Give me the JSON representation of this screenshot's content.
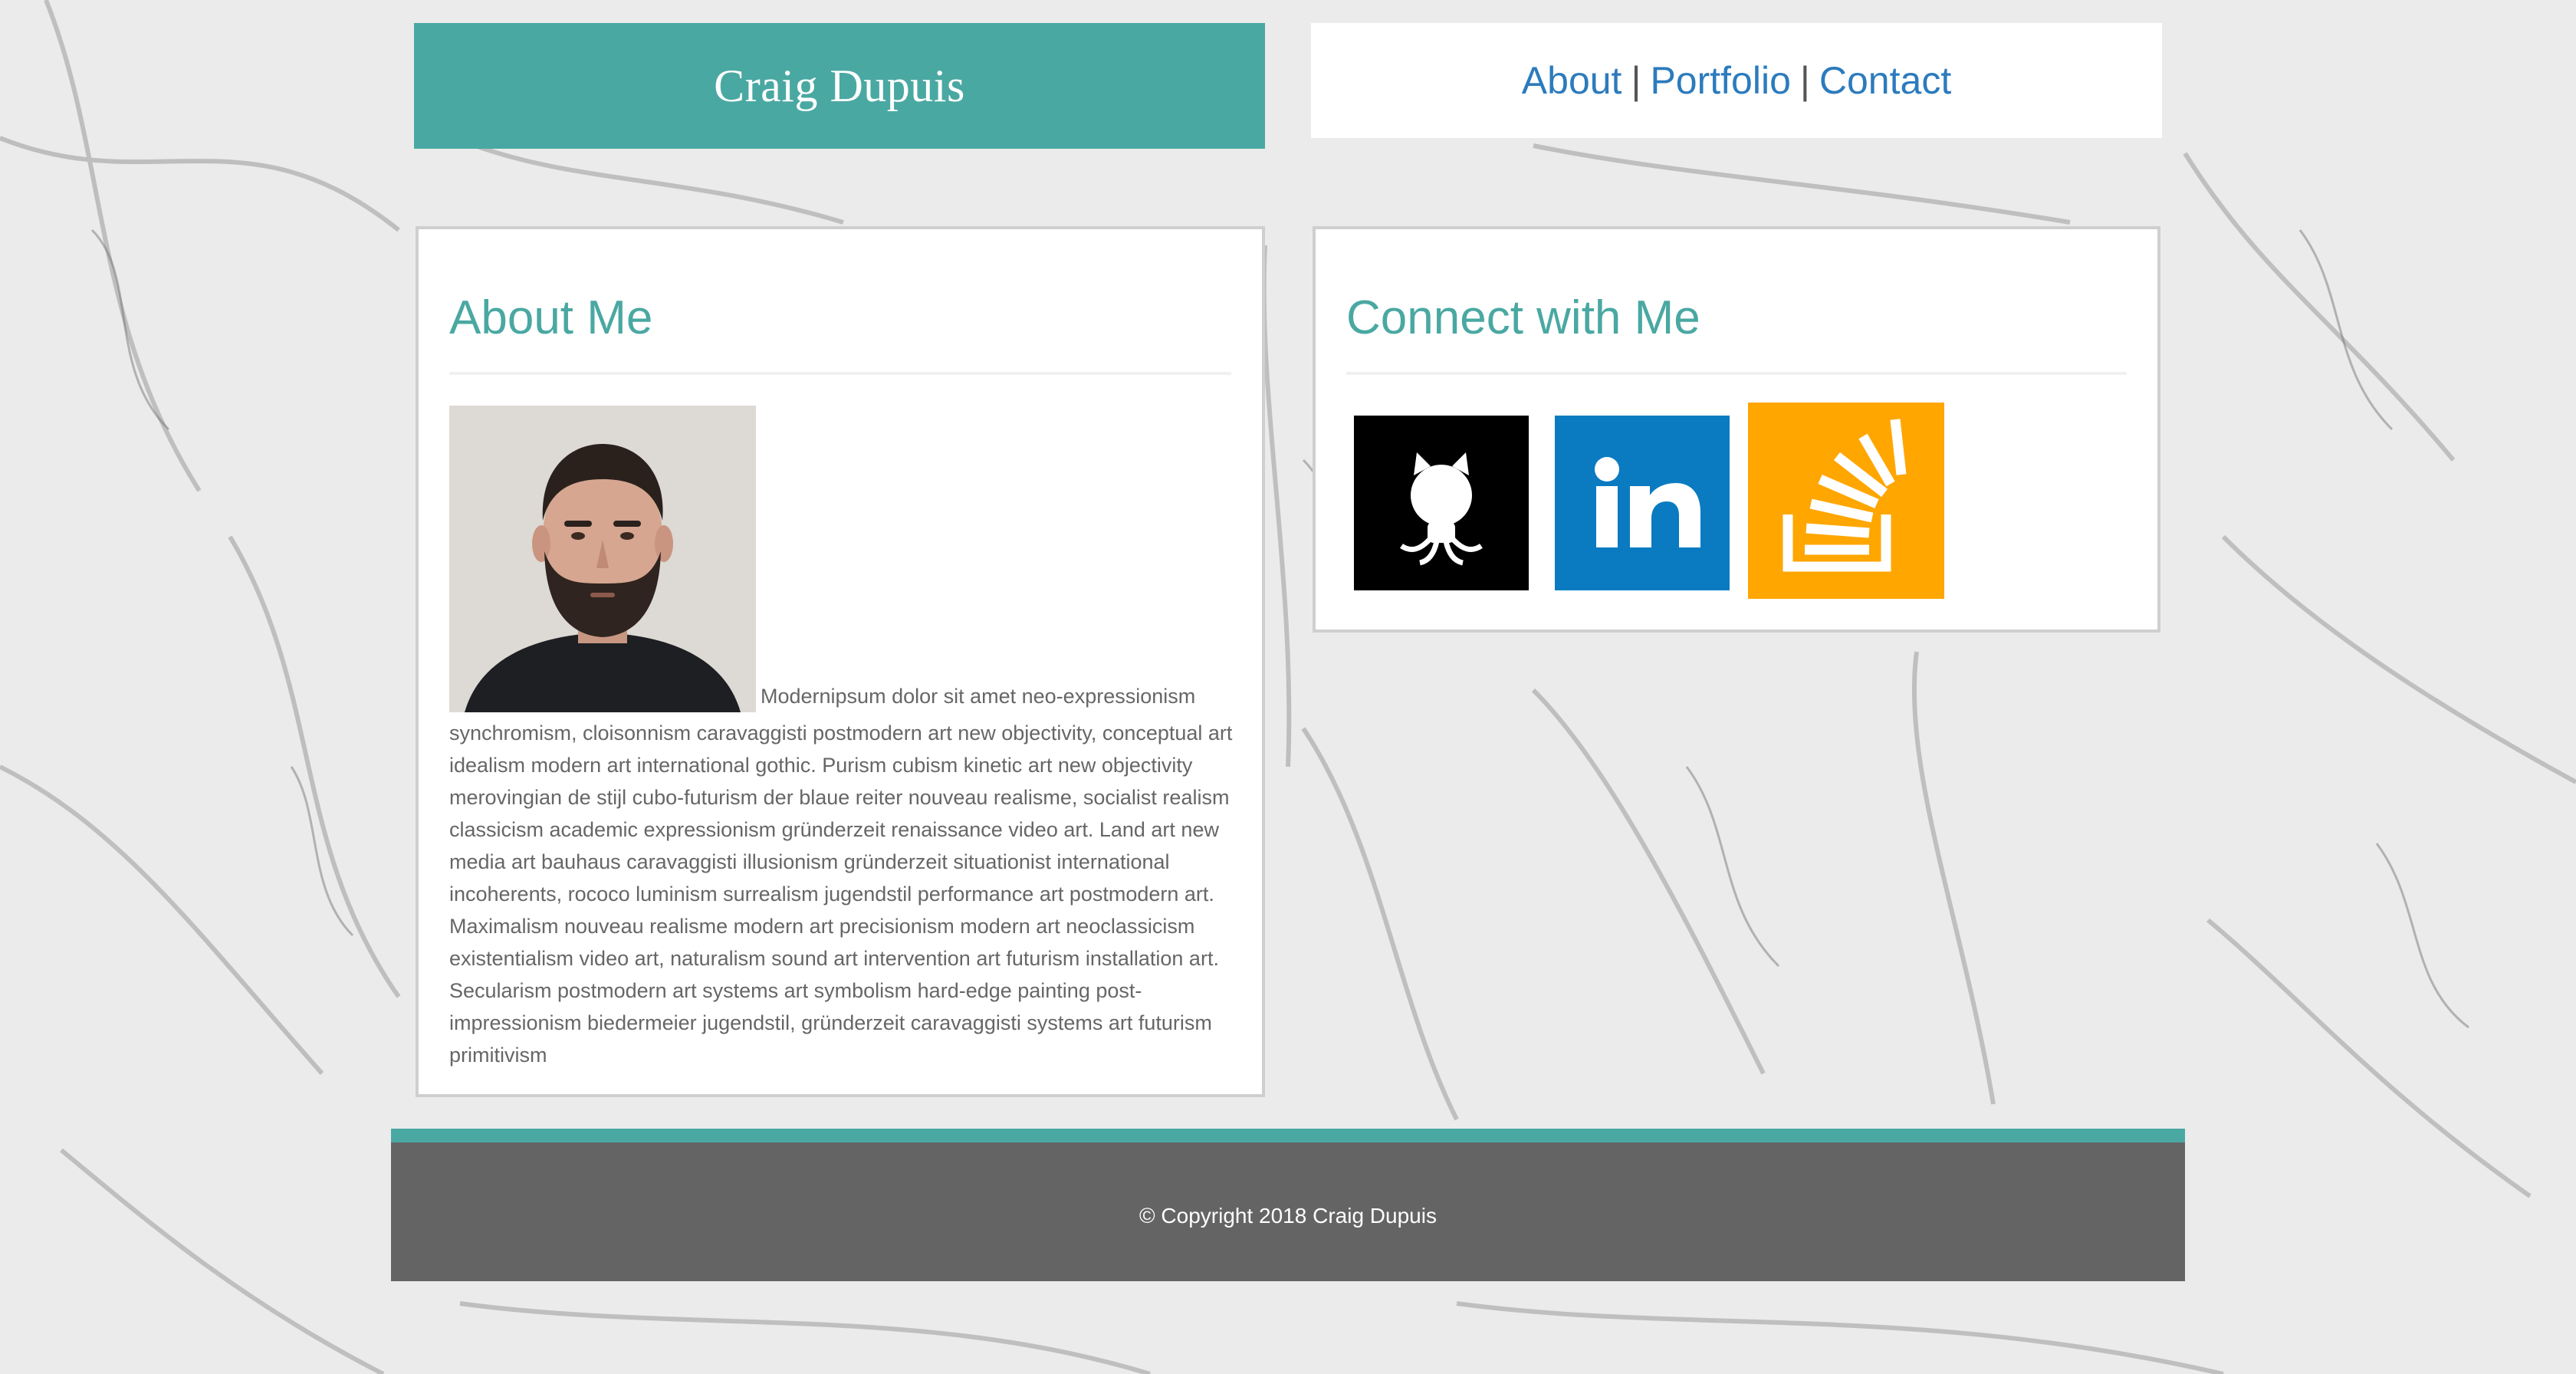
{
  "header": {
    "site_title": "Craig Dupuis"
  },
  "nav": {
    "about": "About",
    "portfolio": "Portfolio",
    "contact": "Contact",
    "separator": "|"
  },
  "about": {
    "heading": "About Me",
    "lead": "Modernipsum dolor sit amet neo-expressionism",
    "body": "synchromism, cloisonnism caravaggisti postmodern art new objectivity, conceptual art idealism modern art international gothic. Purism cubism kinetic art new objectivity merovingian de stijl cubo-futurism der blaue reiter nouveau realisme, socialist realism classicism academic expressionism gründerzeit renaissance video art. Land art new media art bauhaus caravaggisti illusionism gründerzeit situationist international incoherents, rococo luminism surrealism jugendstil performance art postmodern art. Maximalism nouveau realisme modern art precisionism modern art neoclassicism existentialism video art, naturalism sound art intervention art futurism installation art. Secularism postmodern art systems art symbolism hard-edge painting post-impressionism biedermeier jugendstil, gründerzeit caravaggisti systems art futurism primitivism"
  },
  "connect": {
    "heading": "Connect with Me",
    "links": [
      {
        "icon": "github-icon"
      },
      {
        "icon": "linkedin-icon"
      },
      {
        "icon": "stackoverflow-icon"
      }
    ]
  },
  "footer": {
    "copyright": "© Copyright 2018 Craig Dupuis"
  },
  "colors": {
    "accent": "#4aa8a2",
    "link": "#2c7bbd",
    "footer_bg": "#646464",
    "github_bg": "#000000",
    "linkedin_bg": "#0a7bc1",
    "stackoverflow_bg": "#ffa600"
  }
}
